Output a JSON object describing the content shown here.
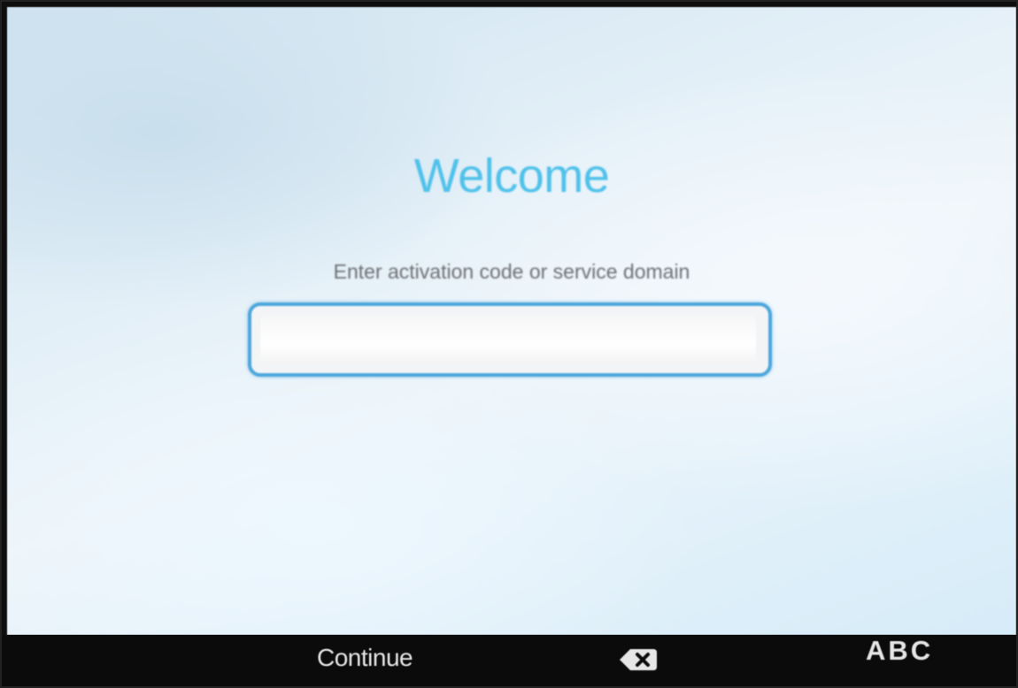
{
  "welcome": {
    "title": "Welcome",
    "prompt": "Enter activation code or service domain"
  },
  "activation_input": {
    "value": "",
    "placeholder": ""
  },
  "softkeys": {
    "continue_label": "Continue",
    "backspace_icon": "backspace-icon",
    "abc_label": "ABC"
  },
  "colors": {
    "title": "#4fc1ea",
    "input_border": "#4ea7dc",
    "softkey_bar": "#0b0b0b",
    "softkey_text": "#e6e6e6"
  }
}
